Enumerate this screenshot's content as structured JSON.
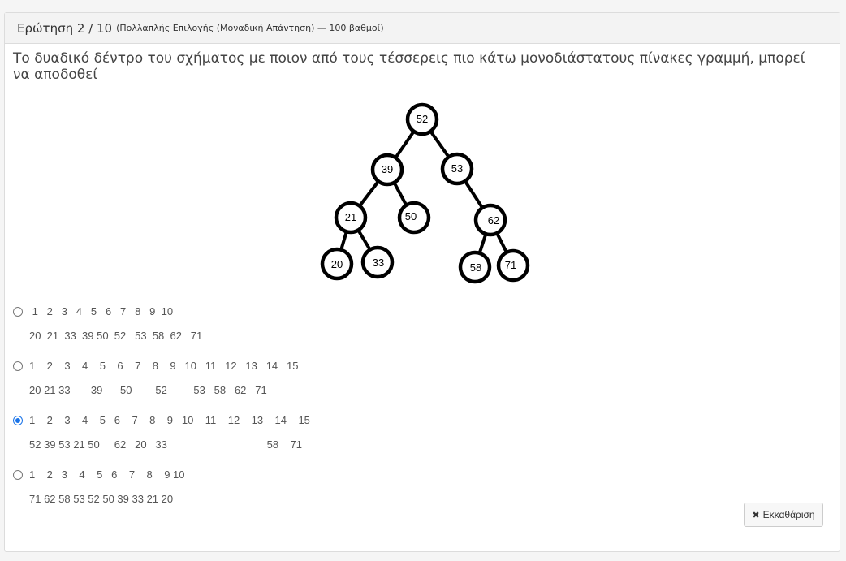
{
  "header": {
    "title": "Ερώτηση 2 / 10",
    "subtitle": "(Πολλαπλής Επιλογής (Μοναδική Απάντηση) — 100 βαθμοί)"
  },
  "question": {
    "text": "Το δυαδικό δέντρο του σχήματος με ποιον από τους τέσσερεις πιο κάτω μονοδιάστατους πίνακες γραμμή, μπορεί να αποδοθεί"
  },
  "tree_nodes": {
    "n52": "52",
    "n39": "39",
    "n53": "53",
    "n21": "21",
    "n50": "50",
    "n62": "62",
    "n20": "20",
    "n33": "33",
    "n58": "58",
    "n71": "71"
  },
  "options": [
    {
      "checked": false,
      "line1": " 1   2   3   4   5   6   7   8   9  10",
      "line2": "20  21  33  39 50  52   53  58  62   71"
    },
    {
      "checked": false,
      "line1": "1    2    3    4    5    6    7    8    9   10   11   12   13   14   15",
      "line2": "20 21 33       39      50        52         53   58   62   71"
    },
    {
      "checked": true,
      "line1": "1    2    3    4    5   6    7    8    9   10    11    12    13    14    15",
      "line2": "52 39 53 21 50     62   20   33                                  58    71"
    },
    {
      "checked": false,
      "line1": "1    2   3    4    5   6    7    8    9 10",
      "line2": "71 62 58 53 52 50 39 33 21 20"
    }
  ],
  "clear_button": {
    "label": "Εκκαθάριση",
    "icon": "times-icon"
  }
}
